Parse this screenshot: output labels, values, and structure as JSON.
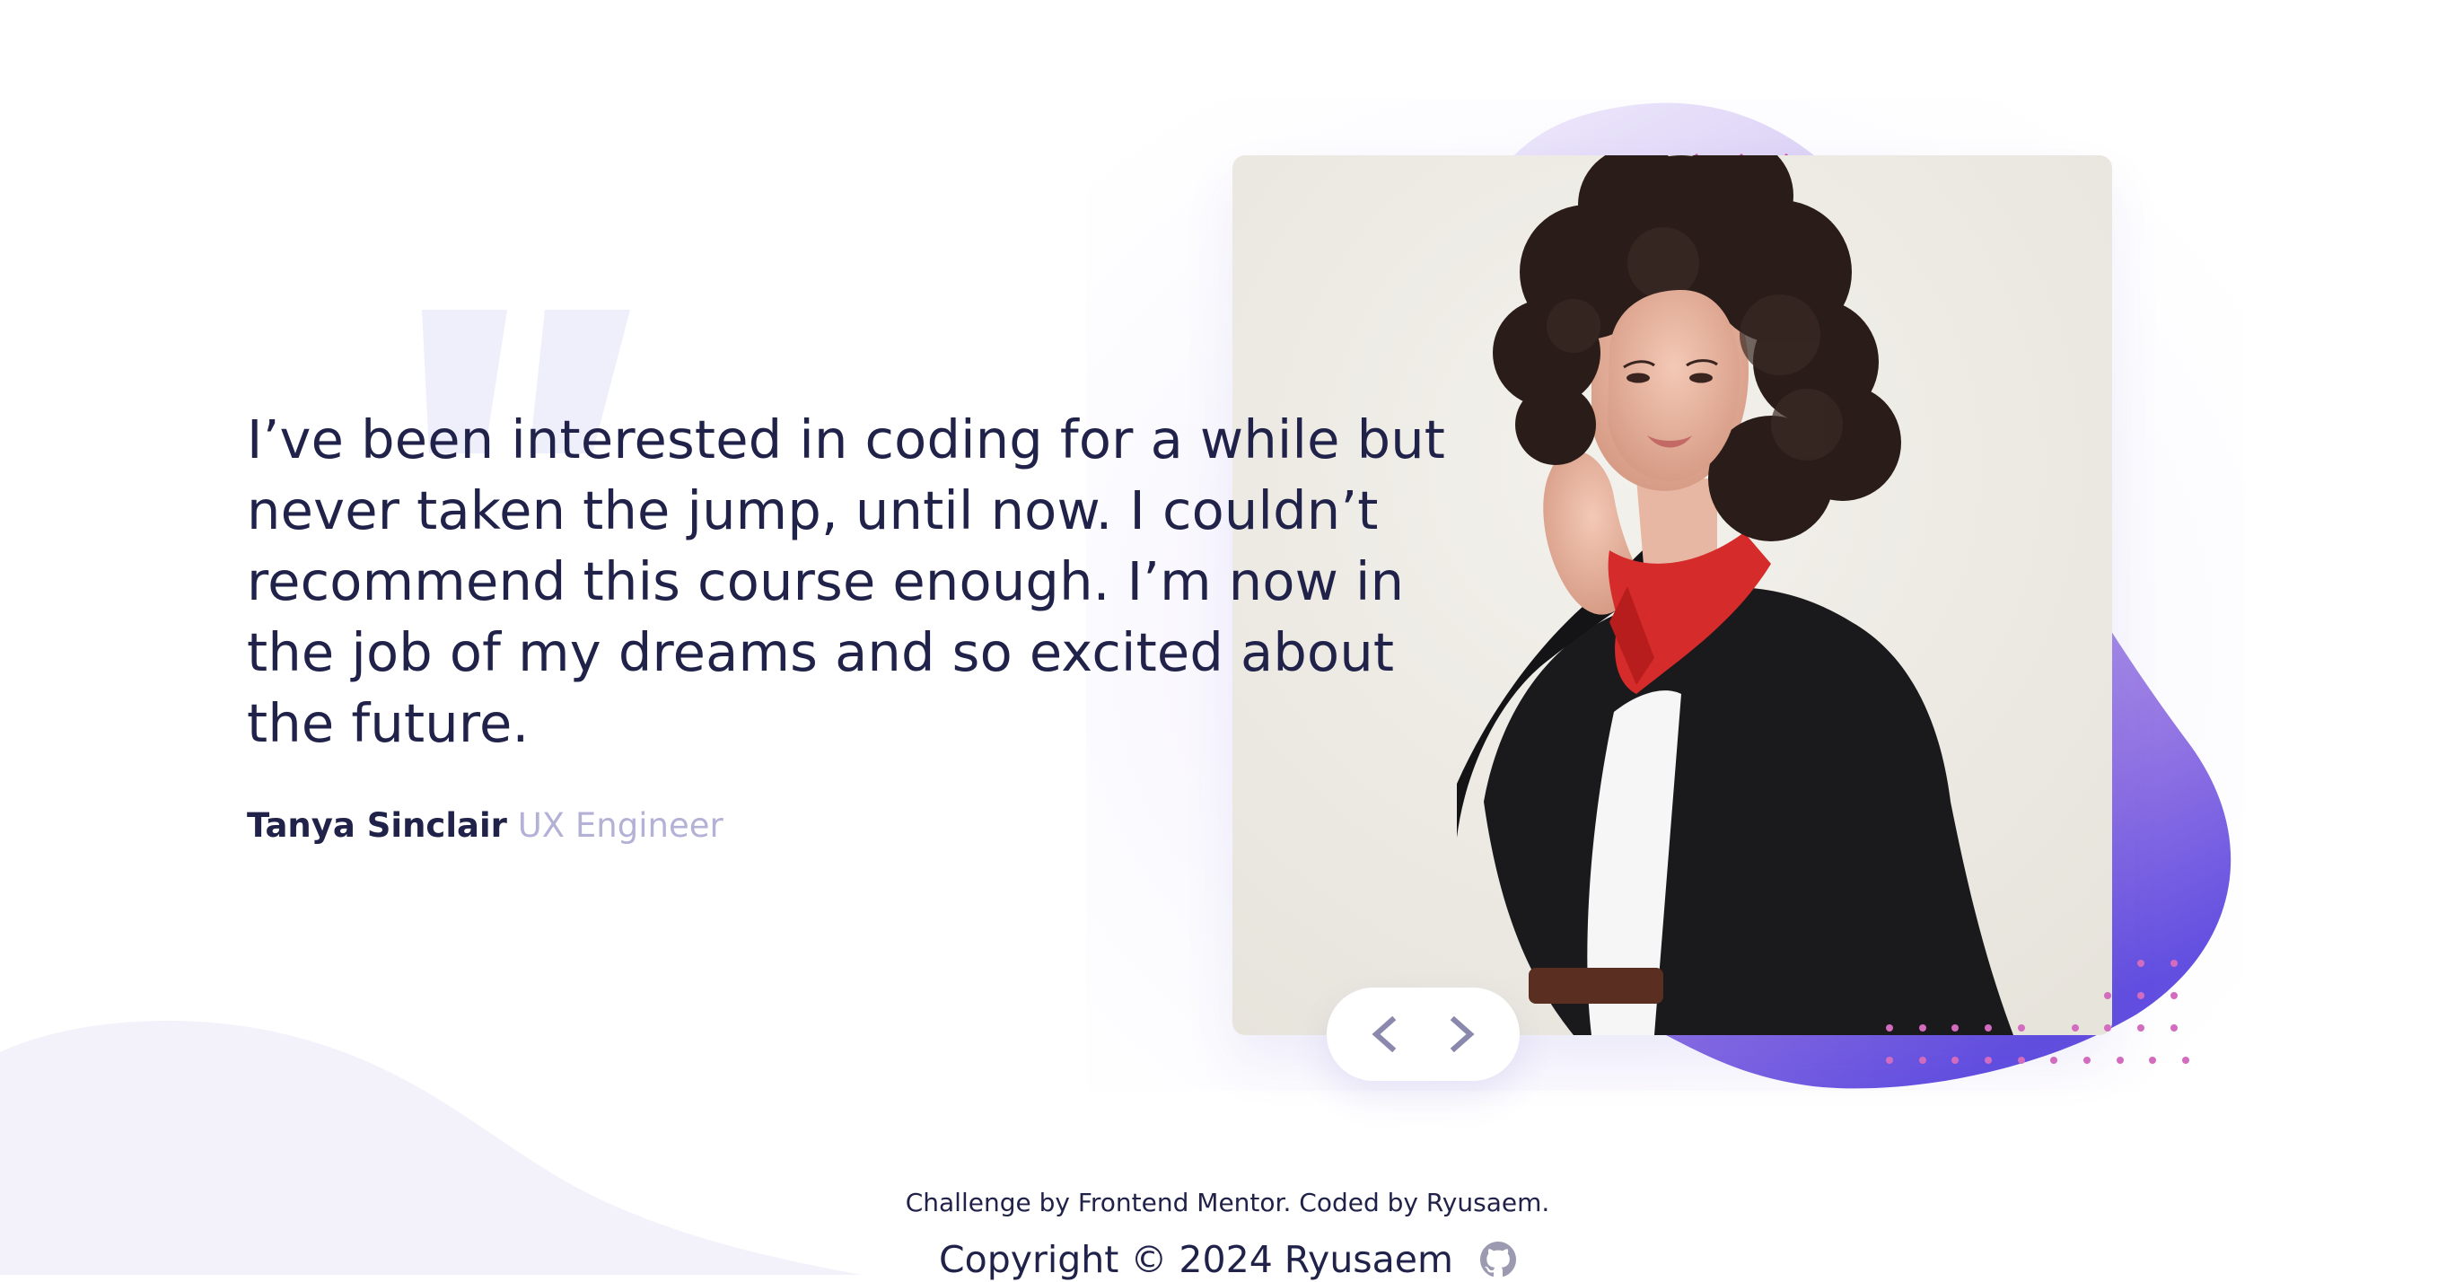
{
  "testimonial": {
    "quote": "I’ve been interested in coding for a while but never taken the jump, until now. I couldn’t recommend this course enough. I’m now in the job of my dreams and so excited about the future.",
    "author_name": "Tanya Sinclair",
    "author_role": "UX Engineer",
    "photo_alt": "Tanya Sinclair"
  },
  "navigation": {
    "prev_icon": "chevron-left-icon",
    "next_icon": "chevron-right-icon"
  },
  "footer": {
    "credit": "Challenge by Frontend Mentor. Coded by Ryusaem.",
    "copyright": "Copyright © 2024 Ryusaem",
    "github_icon": "github-icon"
  },
  "colors": {
    "text_dark": "#202249",
    "text_muted": "#b3b1d6",
    "accent_purple": "#6a4fe0",
    "accent_pink": "#c85aa8",
    "bg_light": "#f3f2fa"
  }
}
